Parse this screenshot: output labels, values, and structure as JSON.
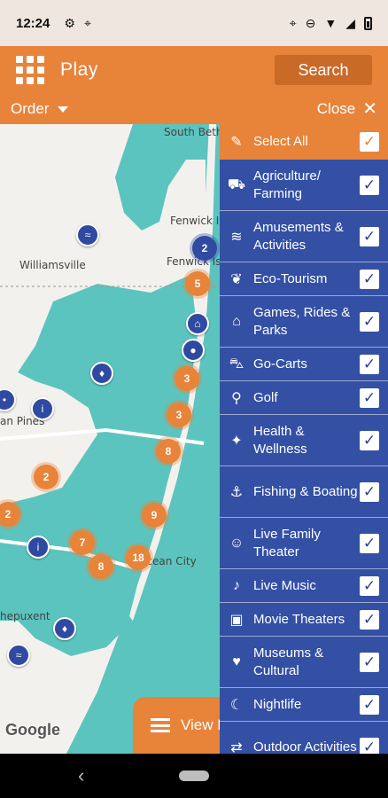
{
  "status_bar": {
    "time": "12:24",
    "left_icons": [
      "gear-icon",
      "location-icon"
    ],
    "right_icons": [
      "location-icon",
      "dnd-icon",
      "wifi-icon",
      "signal-icon",
      "battery-icon"
    ]
  },
  "app_bar": {
    "title": "Play",
    "search_label": "Search"
  },
  "sub_bar": {
    "order_label": "Order",
    "close_label": "Close"
  },
  "map": {
    "labels": {
      "south_beth": "South Beth",
      "fenwick": "Fenwick I",
      "fenwick_is": "Fenwick Is",
      "williamsville": "Williamsville",
      "pines": "an Pines",
      "ocean_city": "Ocean City",
      "hepuxent": "hepuxent"
    },
    "clusters": {
      "c1": "2",
      "c2": "5",
      "c3": "3",
      "c4": "3",
      "c5": "8",
      "c6": "2",
      "c7": "2",
      "c8": "9",
      "c9": "7",
      "c10": "8",
      "c11": "18"
    },
    "google_text": "Google",
    "view_list_label": "View L"
  },
  "filter_panel": {
    "select_all_label": "Select All",
    "items": [
      {
        "label": "Agriculture/ Farming",
        "icon": "tractor-icon",
        "checked": true
      },
      {
        "label": "Amusements & Activities",
        "icon": "roller-coaster-icon",
        "checked": true
      },
      {
        "label": "Eco-Tourism",
        "icon": "leaf-icon",
        "checked": true
      },
      {
        "label": "Games, Rides & Parks",
        "icon": "carousel-icon",
        "checked": true
      },
      {
        "label": "Go-Carts",
        "icon": "go-cart-icon",
        "checked": true
      },
      {
        "label": "Golf",
        "icon": "golf-icon",
        "checked": true
      },
      {
        "label": "Health & Wellness",
        "icon": "wellness-icon",
        "checked": true
      },
      {
        "label": "Fishing & Boating",
        "icon": "fishing-icon",
        "checked": true
      },
      {
        "label": "Live Family Theater",
        "icon": "theater-masks-icon",
        "checked": true
      },
      {
        "label": "Live Music",
        "icon": "music-note-icon",
        "checked": true
      },
      {
        "label": "Movie Theaters",
        "icon": "movie-camera-icon",
        "checked": true
      },
      {
        "label": "Museums & Cultural",
        "icon": "museum-icon",
        "checked": true
      },
      {
        "label": "Nightlife",
        "icon": "nightlife-icon",
        "checked": true
      },
      {
        "label": "Outdoor Activities",
        "icon": "signpost-icon",
        "checked": true
      }
    ]
  },
  "colors": {
    "brand_orange": "#e8833a",
    "panel_blue": "#3450a5",
    "water": "#5cc4be"
  }
}
